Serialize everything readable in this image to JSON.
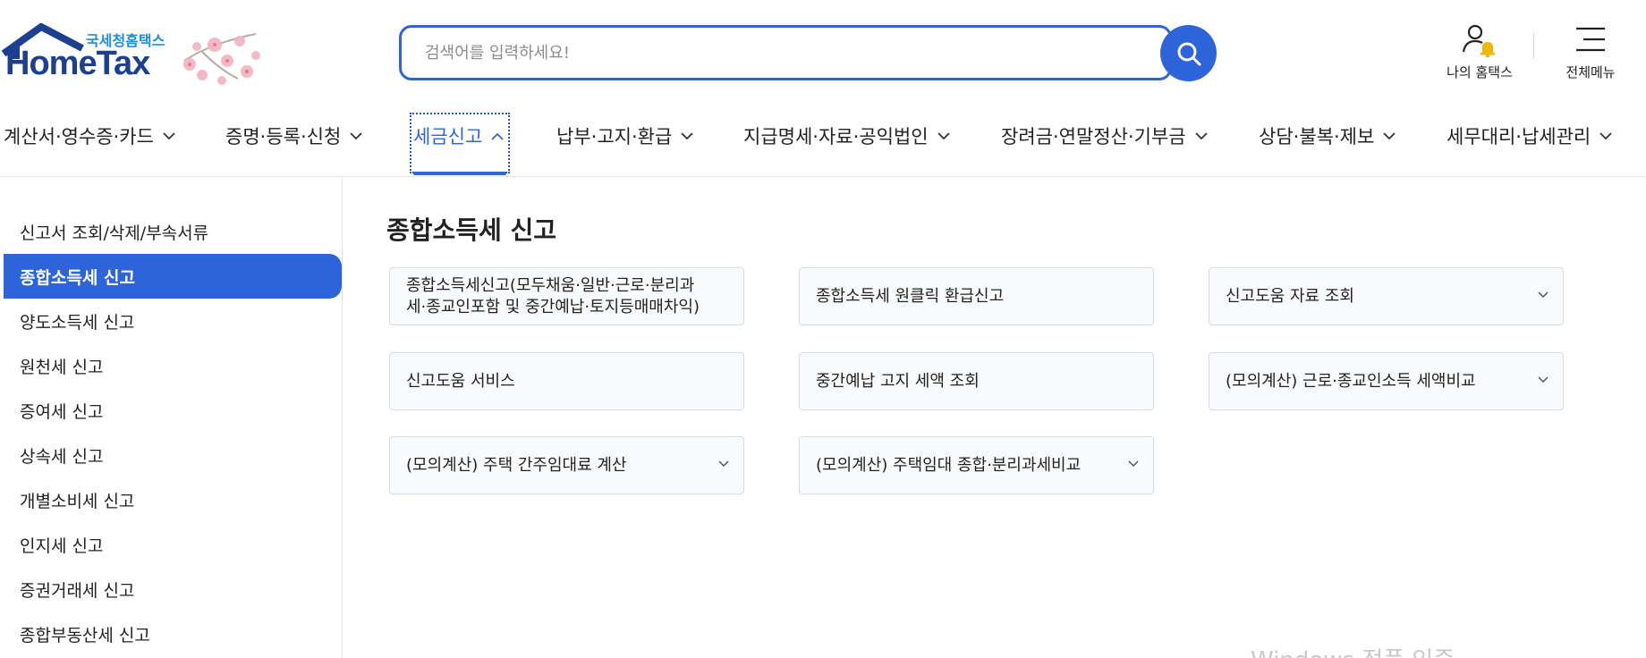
{
  "header": {
    "logo_kr": "국세청홈택스",
    "logo_en": "HomeTax",
    "search_placeholder": "검색어를 입력하세요!",
    "my_hometax_label": "나의 홈택스",
    "all_menu_label": "전체메뉴",
    "brand_color": "#2e64d9"
  },
  "gnb": {
    "items": [
      {
        "label": "계산서·영수증·카드"
      },
      {
        "label": "증명·등록·신청"
      },
      {
        "label": "세금신고"
      },
      {
        "label": "납부·고지·환급"
      },
      {
        "label": "지급명세·자료·공익법인"
      },
      {
        "label": "장려금·연말정산·기부금"
      },
      {
        "label": "상담·불복·제보"
      },
      {
        "label": "세무대리·납세관리"
      }
    ],
    "active": "세금신고"
  },
  "sidebar": {
    "items": [
      {
        "label": "신고서 조회/삭제/부속서류"
      },
      {
        "label": "종합소득세 신고"
      },
      {
        "label": "양도소득세 신고"
      },
      {
        "label": "원천세 신고"
      },
      {
        "label": "증여세 신고"
      },
      {
        "label": "상속세 신고"
      },
      {
        "label": "개별소비세 신고"
      },
      {
        "label": "인지세 신고"
      },
      {
        "label": "증권거래세 신고"
      },
      {
        "label": "종합부동산세 신고"
      }
    ],
    "active": "종합소득세 신고"
  },
  "main": {
    "title": "종합소득세 신고",
    "cards": [
      {
        "line1": "종합소득세신고(모두채움·일반·근로·분리과",
        "line2": "세·종교인포함 및 중간예납·토지등매매차익)",
        "has_dropdown": false
      },
      {
        "line1": "종합소득세 원클릭 환급신고",
        "line2": "",
        "has_dropdown": false
      },
      {
        "line1": "신고도움 자료 조회",
        "line2": "",
        "has_dropdown": true
      },
      {
        "line1": "신고도움 서비스",
        "line2": "",
        "has_dropdown": false
      },
      {
        "line1": "중간예납 고지 세액 조회",
        "line2": "",
        "has_dropdown": false
      },
      {
        "line1": "(모의계산) 근로·종교인소득 세액비교",
        "line2": "",
        "has_dropdown": true
      },
      {
        "line1": "(모의계산) 주택 간주임대료 계산",
        "line2": "",
        "has_dropdown": true
      },
      {
        "line1": "(모의계산) 주택임대 종합·분리과세비교",
        "line2": "",
        "has_dropdown": true
      }
    ]
  },
  "watermark": "Windows 정품 인증"
}
